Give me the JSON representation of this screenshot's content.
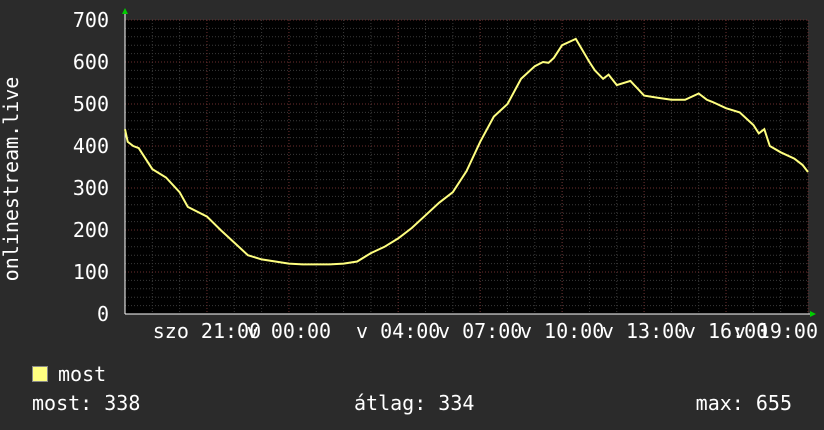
{
  "colors": {
    "background": "#2b2b2b",
    "plot_background": "#000000",
    "grid_minor": "#3a3a3a",
    "grid_major": "#6b2e2e",
    "axis_arrow": "#00cc00",
    "series": "#ffff80",
    "text": "#ffffff"
  },
  "chart_data": {
    "type": "line",
    "title": "",
    "xlabel": "",
    "ylabel": "onlinestream.live",
    "ylim": [
      0,
      700
    ],
    "y_ticks": [
      0,
      100,
      200,
      300,
      400,
      500,
      600,
      700
    ],
    "x_tick_labels": [
      "szo 21:00",
      "v 00:00",
      "v 04:00",
      "v 07:00",
      "v 10:00",
      "v 13:00",
      "v 16:00",
      "v 19:00"
    ],
    "x_tick_hours": [
      21,
      24,
      28,
      31,
      34,
      37,
      40,
      43
    ],
    "x_start_hour": 18,
    "x_end_hour": 43,
    "grid": true,
    "series": [
      {
        "name": "most",
        "x": [
          18.0,
          18.1,
          18.3,
          18.5,
          19.0,
          19.5,
          20.0,
          20.3,
          21.0,
          21.5,
          22.0,
          22.5,
          23.0,
          23.5,
          24.0,
          24.5,
          25.0,
          25.5,
          26.0,
          26.5,
          27.0,
          27.5,
          28.0,
          28.5,
          29.0,
          29.5,
          30.0,
          30.5,
          31.0,
          31.5,
          32.0,
          32.5,
          33.0,
          33.3,
          33.5,
          33.7,
          34.0,
          34.5,
          35.0,
          35.2,
          35.5,
          35.7,
          36.0,
          36.5,
          37.0,
          37.5,
          38.0,
          38.5,
          39.0,
          39.3,
          39.5,
          40.0,
          40.5,
          41.0,
          41.2,
          41.4,
          41.6,
          42.0,
          42.5,
          42.8,
          43.0
        ],
        "y": [
          440,
          410,
          400,
          395,
          345,
          325,
          290,
          255,
          232,
          200,
          170,
          140,
          130,
          125,
          120,
          118,
          118,
          118,
          120,
          125,
          145,
          160,
          180,
          205,
          235,
          265,
          290,
          340,
          410,
          470,
          500,
          560,
          590,
          600,
          598,
          610,
          640,
          655,
          600,
          580,
          560,
          570,
          545,
          555,
          520,
          515,
          510,
          510,
          525,
          510,
          505,
          490,
          480,
          450,
          430,
          440,
          400,
          385,
          370,
          355,
          338
        ]
      }
    ]
  },
  "legend": {
    "label": "most"
  },
  "stats": {
    "current": "most: 338",
    "average": "átlag: 334",
    "maximum": "max: 655"
  }
}
